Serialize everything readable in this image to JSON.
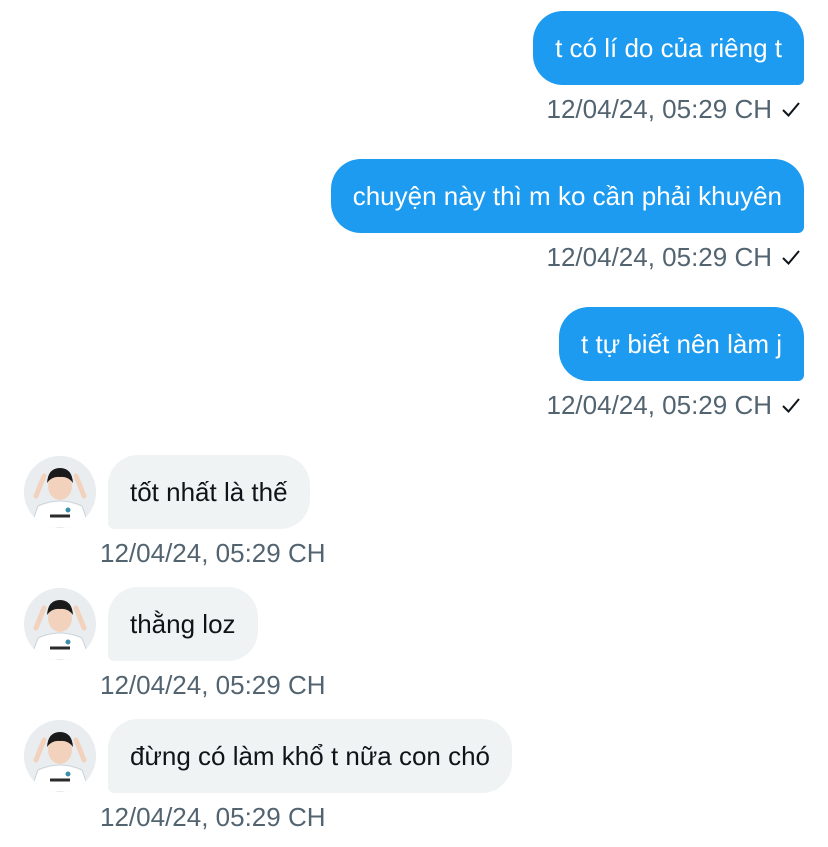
{
  "thread": {
    "messages": [
      {
        "direction": "out",
        "text": "t có lí do của riêng t",
        "time": "12/04/24, 05:29 CH",
        "status": "check-icon"
      },
      {
        "direction": "out",
        "text": "chuyện này thì m ko cần phải khuyên",
        "time": "12/04/24, 05:29 CH",
        "status": "check-icon"
      },
      {
        "direction": "out",
        "text": "t tự biết nên làm j",
        "time": "12/04/24, 05:29 CH",
        "status": "check-icon"
      },
      {
        "direction": "in",
        "text": "tốt nhất là thế",
        "time": "12/04/24, 05:29 CH",
        "avatar": "user-avatar"
      },
      {
        "direction": "in",
        "text": "thằng loz",
        "time": "12/04/24, 05:29 CH",
        "avatar": "user-avatar"
      },
      {
        "direction": "in",
        "text": "đừng có làm khổ t nữa con chó",
        "time": "12/04/24, 05:29 CH",
        "avatar": "user-avatar"
      }
    ]
  },
  "colors": {
    "outgoing_bubble": "#1d9bf0",
    "incoming_bubble": "#eff3f4",
    "timestamp": "#536471"
  }
}
